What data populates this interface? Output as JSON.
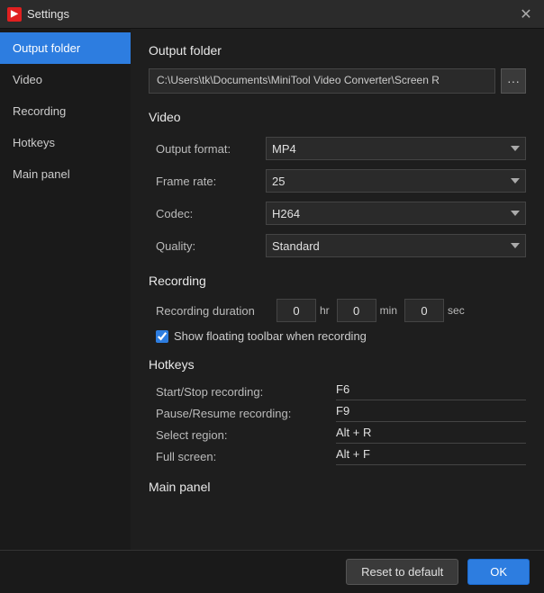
{
  "titleBar": {
    "title": "Settings",
    "icon": "▶",
    "closeLabel": "✕"
  },
  "sidebar": {
    "items": [
      {
        "id": "output-folder",
        "label": "Output folder",
        "active": true
      },
      {
        "id": "video",
        "label": "Video",
        "active": false
      },
      {
        "id": "recording",
        "label": "Recording",
        "active": false
      },
      {
        "id": "hotkeys",
        "label": "Hotkeys",
        "active": false
      },
      {
        "id": "main-panel",
        "label": "Main panel",
        "active": false
      }
    ]
  },
  "outputFolder": {
    "sectionTitle": "Output folder",
    "path": "C:\\Users\\tk\\Documents\\MiniTool Video Converter\\Screen R",
    "browseIcon": "···"
  },
  "video": {
    "sectionTitle": "Video",
    "fields": [
      {
        "label": "Output format:",
        "value": "MP4"
      },
      {
        "label": "Frame rate:",
        "value": "25"
      },
      {
        "label": "Codec:",
        "value": "H264"
      },
      {
        "label": "Quality:",
        "value": "Standard"
      }
    ]
  },
  "recording": {
    "sectionTitle": "Recording",
    "duration": {
      "label": "Recording duration",
      "hrValue": "0",
      "hrUnit": "hr",
      "minValue": "0",
      "minUnit": "min",
      "secValue": "0",
      "secUnit": "sec"
    },
    "showToolbar": {
      "checked": true,
      "label": "Show floating toolbar when recording"
    }
  },
  "hotkeys": {
    "sectionTitle": "Hotkeys",
    "items": [
      {
        "label": "Start/Stop recording:",
        "value": "F6"
      },
      {
        "label": "Pause/Resume recording:",
        "value": "F9"
      },
      {
        "label": "Select region:",
        "value": "Alt + R"
      },
      {
        "label": "Full screen:",
        "value": "Alt + F"
      }
    ]
  },
  "mainPanel": {
    "sectionTitle": "Main panel"
  },
  "bottomBar": {
    "resetLabel": "Reset to default",
    "okLabel": "OK"
  }
}
